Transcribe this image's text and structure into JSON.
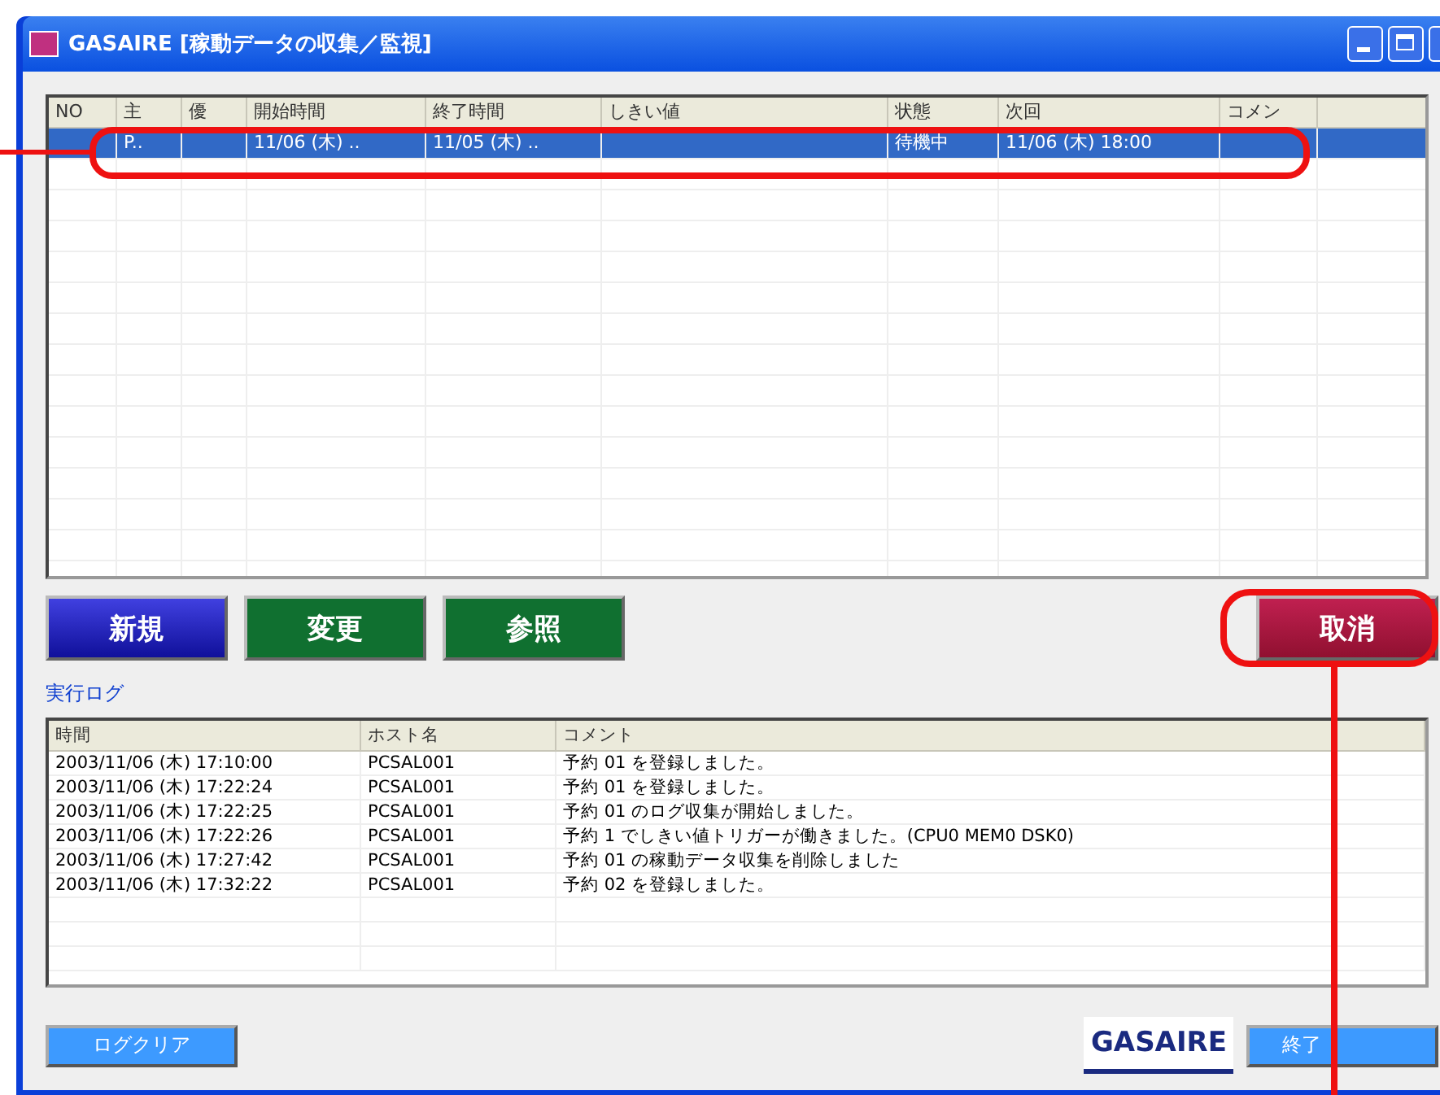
{
  "window": {
    "title": "GASAIRE [稼動データの収集／監視]"
  },
  "schedule_table": {
    "columns": [
      "NO",
      "主",
      "優",
      "開始時間",
      "終了時間",
      "しきい値",
      "状態",
      "次回",
      "コメン"
    ],
    "rows": [
      {
        "selected": true,
        "cells": {
          "column_2": "P..",
          "column_4": "11/06 (木) ..",
          "column_5": "11/05 (木) ..",
          "column_7": "待機中",
          "column_8": "11/06 (木) 18:00"
        }
      }
    ]
  },
  "action_buttons": [
    {
      "label": "新規",
      "kind": "new"
    },
    {
      "label": "変更",
      "kind": "edit"
    },
    {
      "label": "参照",
      "kind": "edit"
    }
  ],
  "cancel_button": {
    "label": "取消"
  },
  "log": {
    "title": "実行ログ",
    "columns": [
      "時間",
      "ホスト名",
      "コメント"
    ],
    "rows": [
      {
        "time": "2003/11/06 (木) 17:10:00",
        "host": "PCSAL001",
        "comment": "予約 01 を登録しました。"
      },
      {
        "time": "2003/11/06 (木) 17:22:24",
        "host": "PCSAL001",
        "comment": "予約 01 を登録しました。"
      },
      {
        "time": "2003/11/06 (木) 17:22:25",
        "host": "PCSAL001",
        "comment": "予約 01 のログ収集が開始しました。"
      },
      {
        "time": "2003/11/06 (木) 17:22:26",
        "host": "PCSAL001",
        "comment": "予約 1 でしきい値トリガーが働きました。(CPU0 MEM0 DSK0)"
      },
      {
        "time": "2003/11/06 (木) 17:27:42",
        "host": "PCSAL001",
        "comment": "予約 01 の稼動データ収集を削除しました"
      },
      {
        "time": "2003/11/06 (木) 17:32:22",
        "host": "PCSAL001",
        "comment": "予約 02 を登録しました。"
      }
    ]
  },
  "footer": {
    "clear_button": "ログクリア",
    "logo": "GASAIRE",
    "close_button": "終了"
  }
}
